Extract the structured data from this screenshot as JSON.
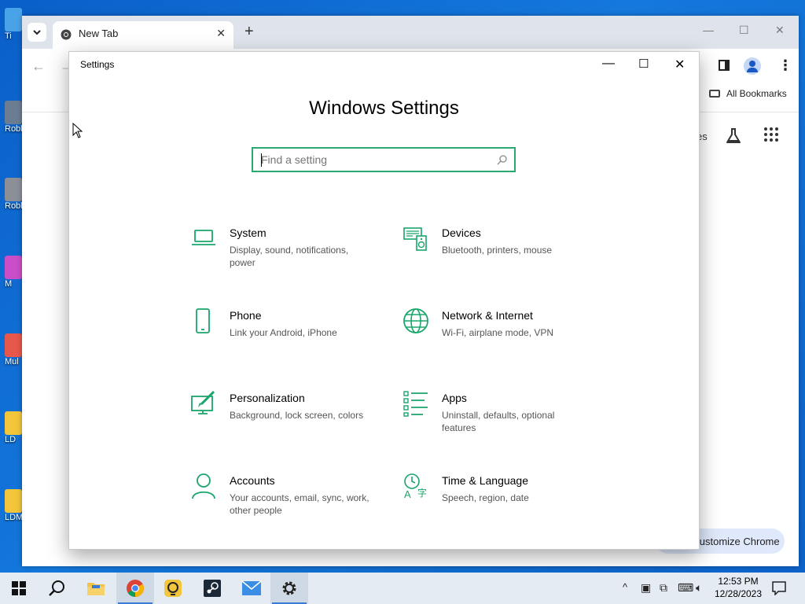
{
  "desktop": {
    "icons": [
      {
        "label": "Ti",
        "color": "#4aa3e8"
      },
      {
        "label": "Robl",
        "color": "#6b7d93"
      },
      {
        "label": "Robl",
        "color": "#8a8f98"
      },
      {
        "label": "M",
        "color": "#c94ec7"
      },
      {
        "label": "Mul",
        "color": "#e8574b"
      },
      {
        "label": "LD",
        "color": "#f2c53a"
      },
      {
        "label": "LDM",
        "color": "#f2c53a"
      }
    ]
  },
  "chrome": {
    "tab_title": "New Tab",
    "bookmarks_label": "All Bookmarks",
    "partial_text": "es",
    "customize_label": "Customize Chrome",
    "new_tab_symbol": "+",
    "close_symbol": "✕",
    "minimize_symbol": "—",
    "maximize_symbol": "☐",
    "back_symbol": "←",
    "forward_symbol": "→"
  },
  "settings": {
    "window_title": "Settings",
    "heading": "Windows Settings",
    "search_placeholder": "Find a setting",
    "accent_color": "#1aa56b",
    "categories": [
      {
        "name": "System",
        "desc": "Display, sound, notifications, power",
        "icon": "laptop-icon"
      },
      {
        "name": "Devices",
        "desc": "Bluetooth, printers, mouse",
        "icon": "keyboard-speaker-icon"
      },
      {
        "name": "Phone",
        "desc": "Link your Android, iPhone",
        "icon": "phone-icon"
      },
      {
        "name": "Network & Internet",
        "desc": "Wi-Fi, airplane mode, VPN",
        "icon": "globe-icon"
      },
      {
        "name": "Personalization",
        "desc": "Background, lock screen, colors",
        "icon": "paint-brush-icon"
      },
      {
        "name": "Apps",
        "desc": "Uninstall, defaults, optional features",
        "icon": "apps-list-icon"
      },
      {
        "name": "Accounts",
        "desc": "Your accounts, email, sync, work, other people",
        "icon": "person-icon"
      },
      {
        "name": "Time & Language",
        "desc": "Speech, region, date",
        "icon": "time-language-icon"
      }
    ]
  },
  "taskbar": {
    "clock_time": "12:53 PM",
    "clock_date": "12/28/2023"
  }
}
